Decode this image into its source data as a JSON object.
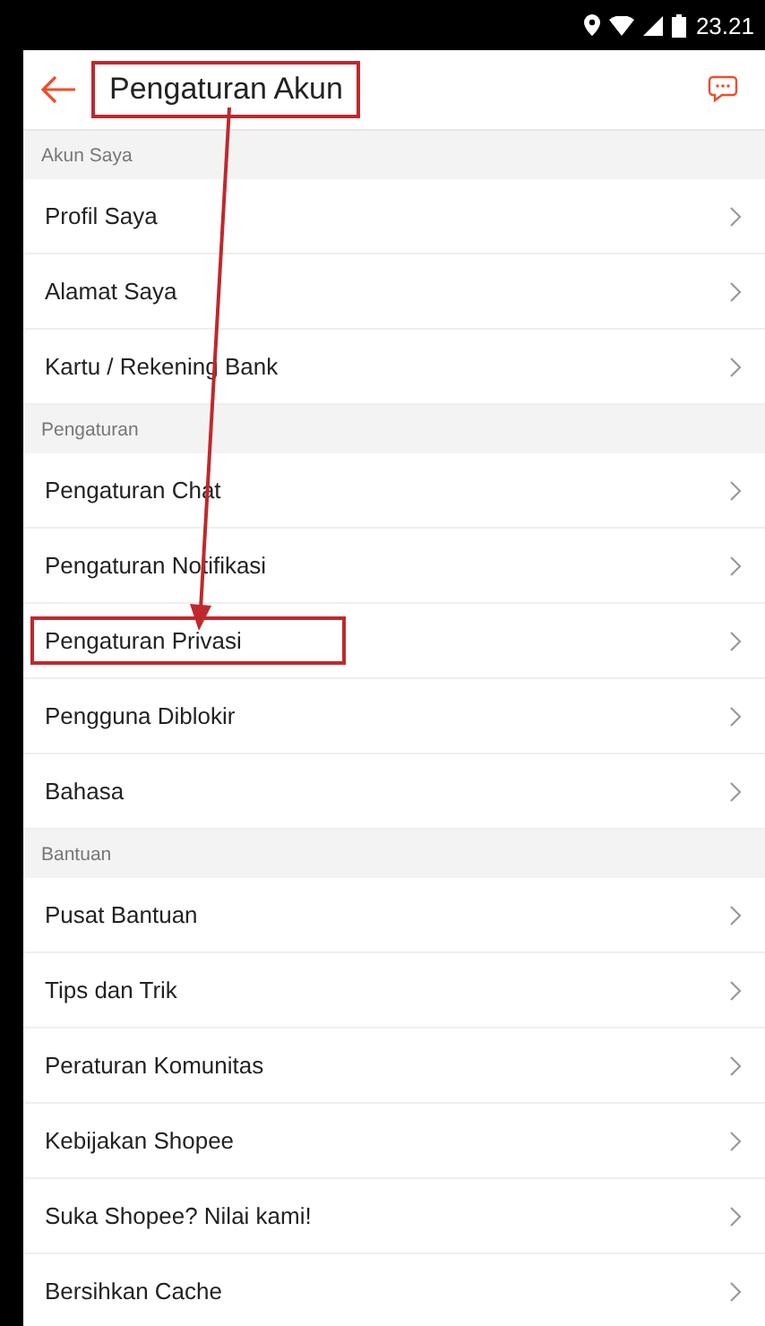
{
  "status_bar": {
    "time": "23.21"
  },
  "header": {
    "title": "Pengaturan Akun",
    "highlighted": true
  },
  "sections": [
    {
      "title": "Akun Saya",
      "items": [
        {
          "label": "Profil Saya",
          "highlighted": false
        },
        {
          "label": "Alamat Saya",
          "highlighted": false
        },
        {
          "label": "Kartu / Rekening Bank",
          "highlighted": false
        }
      ]
    },
    {
      "title": "Pengaturan",
      "items": [
        {
          "label": "Pengaturan Chat",
          "highlighted": false
        },
        {
          "label": "Pengaturan Notifikasi",
          "highlighted": false
        },
        {
          "label": "Pengaturan Privasi",
          "highlighted": true
        },
        {
          "label": "Pengguna Diblokir",
          "highlighted": false
        },
        {
          "label": "Bahasa",
          "highlighted": false
        }
      ]
    },
    {
      "title": "Bantuan",
      "items": [
        {
          "label": "Pusat Bantuan",
          "highlighted": false
        },
        {
          "label": "Tips dan Trik",
          "highlighted": false
        },
        {
          "label": "Peraturan Komunitas",
          "highlighted": false
        },
        {
          "label": "Kebijakan Shopee",
          "highlighted": false
        },
        {
          "label": "Suka Shopee? Nilai kami!",
          "highlighted": false
        },
        {
          "label": "Bersihkan Cache",
          "highlighted": false
        }
      ]
    }
  ]
}
